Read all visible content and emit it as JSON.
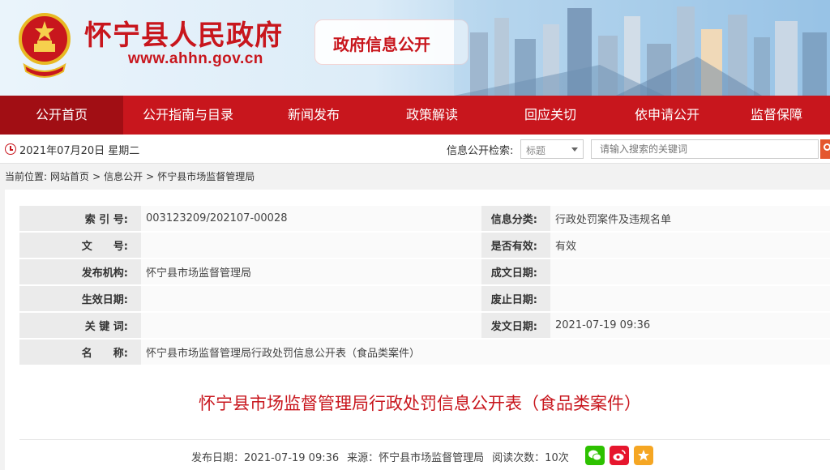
{
  "header": {
    "site_title": "怀宁县人民政府",
    "site_url": "www.ahhn.gov.cn",
    "section_tag": "政府信息公开",
    "emblem_icon": "national-emblem-icon",
    "brand_color": "#c8161d"
  },
  "nav": {
    "items": [
      "公开首页",
      "公开指南与目录",
      "新闻发布",
      "政策解读",
      "回应关切",
      "依申请公开",
      "监督保障"
    ],
    "active": "公开首页"
  },
  "topbar": {
    "date": "2021年07月20日 星期二",
    "search_label": "信息公开检索:",
    "select_value": "标题",
    "search_placeholder": "请输入搜索的关键词"
  },
  "breadcrumb": {
    "label": "当前位置:",
    "items": [
      "网站首页",
      "信息公开",
      "怀宁县市场监督管理局"
    ],
    "separator": ">"
  },
  "meta": {
    "index_label": "索 引 号:",
    "index_value": "003123209/202107-00028",
    "category_label": "信息分类:",
    "category_value": "行政处罚案件及违规名单",
    "docno_label": "文　　号:",
    "docno_value": "",
    "valid_label": "是否有效:",
    "valid_value": "有效",
    "publisher_label": "发布机构:",
    "publisher_value": "怀宁县市场监督管理局",
    "written_label": "成文日期:",
    "written_value": "",
    "effective_label": "生效日期:",
    "effective_value": "",
    "expire_label": "废止日期:",
    "expire_value": "",
    "keywords_label": "关 键 词:",
    "keywords_value": "",
    "issued_label": "发文日期:",
    "issued_value": "2021-07-19 09:36",
    "name_label": "名　　称:",
    "name_value": "怀宁县市场监督管理局行政处罚信息公开表（食品类案件）"
  },
  "article": {
    "title": "怀宁县市场监督管理局行政处罚信息公开表（食品类案件）",
    "publish_date": "发布日期：2021-07-19 09:36",
    "source": "来源：怀宁县市场监督管理局",
    "views": "阅读次数：10次",
    "share_icons": [
      "wechat-icon",
      "weibo-icon",
      "favorite-icon"
    ]
  }
}
